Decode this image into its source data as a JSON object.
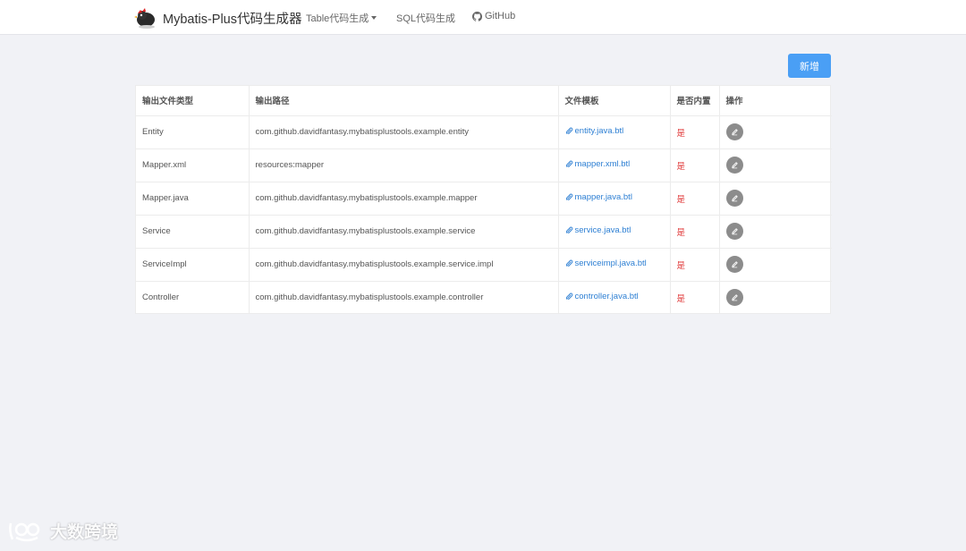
{
  "navbar": {
    "brand": "Mybatis-Plus代码生成器",
    "items": [
      {
        "label": "Table代码生成",
        "dropdown": true
      },
      {
        "label": "SQL代码生成"
      },
      {
        "label": "GitHub",
        "icon": "github-icon"
      }
    ]
  },
  "toolbar": {
    "add_label": "新增"
  },
  "table": {
    "headers": [
      "输出文件类型",
      "输出路径",
      "文件模板",
      "是否内置",
      "操作"
    ],
    "rows": [
      {
        "type": "Entity",
        "path": "com.github.davidfantasy.mybatisplustools.example.entity",
        "template": "entity.java.btl",
        "builtin": "是"
      },
      {
        "type": "Mapper.xml",
        "path": "resources:mapper",
        "template": "mapper.xml.btl",
        "builtin": "是"
      },
      {
        "type": "Mapper.java",
        "path": "com.github.davidfantasy.mybatisplustools.example.mapper",
        "template": "mapper.java.btl",
        "builtin": "是"
      },
      {
        "type": "Service",
        "path": "com.github.davidfantasy.mybatisplustools.example.service",
        "template": "service.java.btl",
        "builtin": "是"
      },
      {
        "type": "ServiceImpl",
        "path": "com.github.davidfantasy.mybatisplustools.example.service.impl",
        "template": "serviceimpl.java.btl",
        "builtin": "是"
      },
      {
        "type": "Controller",
        "path": "com.github.davidfantasy.mybatisplustools.example.controller",
        "template": "controller.java.btl",
        "builtin": "是"
      }
    ]
  },
  "watermark": {
    "text": "大数跨境"
  },
  "colors": {
    "primary": "#4a9ff5",
    "link": "#2d7fd3",
    "builtin": "#e03a3a",
    "edit_button": "#8c8c8c"
  }
}
